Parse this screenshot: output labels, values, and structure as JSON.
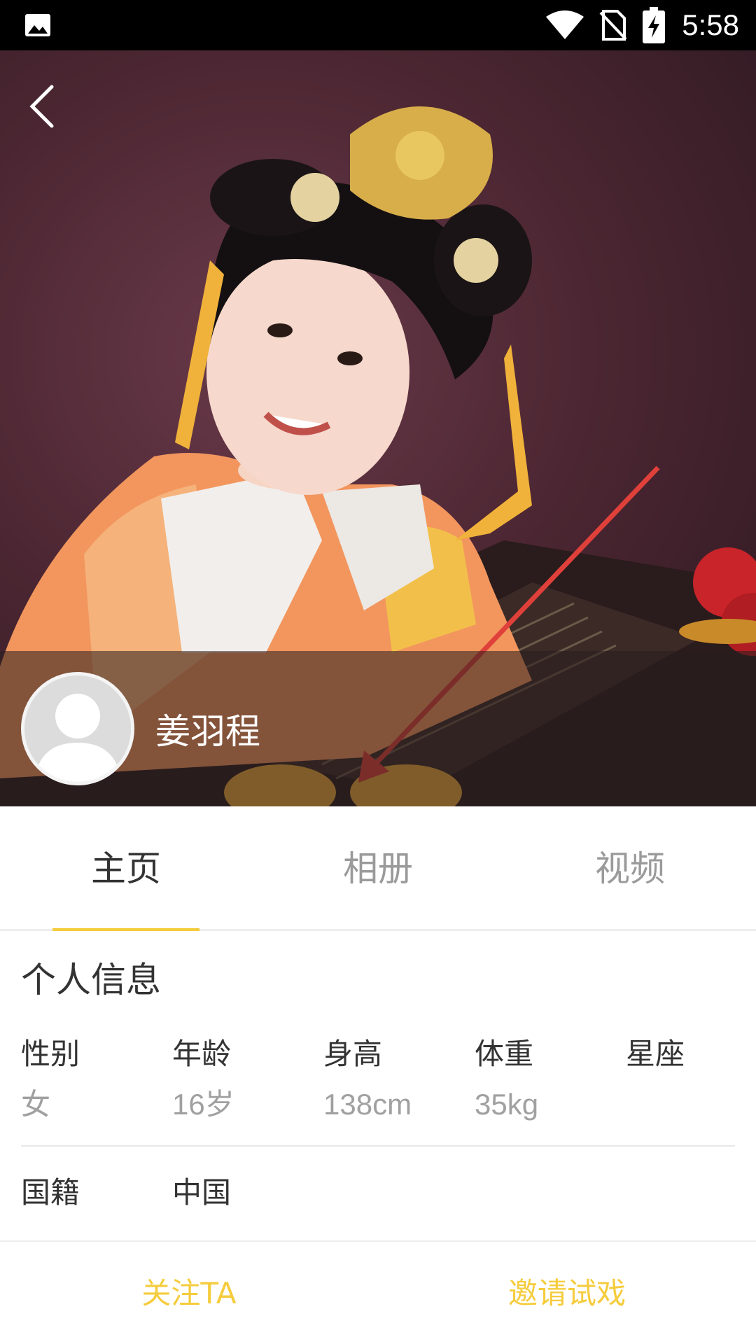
{
  "status_bar": {
    "time": "5:58",
    "icons": [
      "gallery-icon",
      "wifi-icon",
      "no-sim-icon",
      "battery-charging-icon"
    ]
  },
  "header": {
    "back_icon": "chevron-left-icon"
  },
  "profile": {
    "name": "姜羽程",
    "avatar_icon": "default-user-avatar"
  },
  "tabs": [
    {
      "label": "主页",
      "active": true
    },
    {
      "label": "相册",
      "active": false
    },
    {
      "label": "视频",
      "active": false
    }
  ],
  "info": {
    "section_title": "个人信息",
    "fields": [
      {
        "label": "性别",
        "value": "女"
      },
      {
        "label": "年龄",
        "value": "16岁"
      },
      {
        "label": "身高",
        "value": "138cm"
      },
      {
        "label": "体重",
        "value": "35kg"
      },
      {
        "label": "星座",
        "value": ""
      }
    ],
    "nationality": {
      "label": "国籍",
      "value": "中国"
    }
  },
  "actions": {
    "follow_label": "关注TA",
    "invite_label": "邀请试戏"
  },
  "colors": {
    "accent": "#f5cc3d",
    "primary_text": "#333333",
    "secondary_text": "#a0a0a0",
    "annotation_arrow": "#e0403a"
  }
}
